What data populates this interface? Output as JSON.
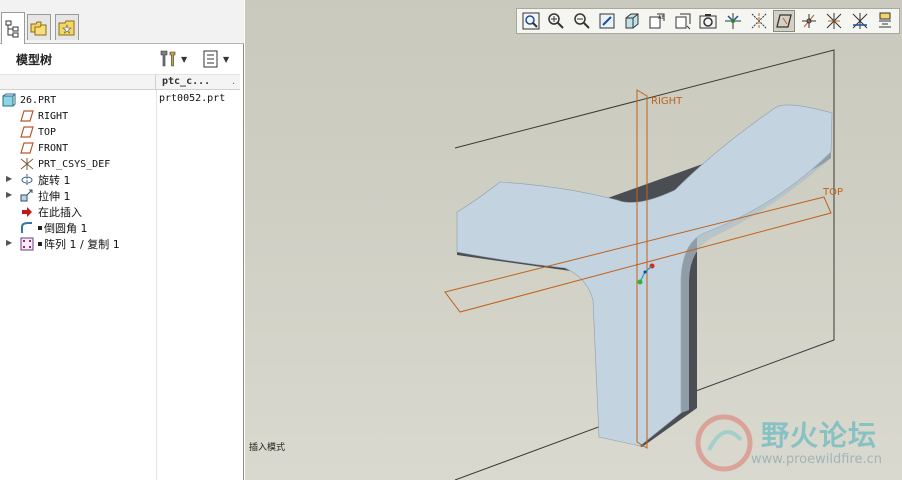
{
  "left_panel": {
    "tabs": [
      {
        "name": "model-tree-tab",
        "icon": "model-tree-icon"
      },
      {
        "name": "folder-browser-tab",
        "icon": "folders-icon"
      },
      {
        "name": "favorites-tab",
        "icon": "favorites-icon"
      }
    ],
    "title": "模型树",
    "settings_icon": "tree-settings-icon",
    "show_icon": "tree-show-icon",
    "columns": {
      "name": "",
      "file": "ptc_c...",
      "extra": "."
    },
    "items": [
      {
        "label": "26.PRT",
        "file": "prt0052.prt",
        "icon": "part-icon",
        "expandable": false
      },
      {
        "label": "RIGHT",
        "icon": "datum-plane-icon",
        "expandable": false
      },
      {
        "label": "TOP",
        "icon": "datum-plane-icon",
        "expandable": false
      },
      {
        "label": "FRONT",
        "icon": "datum-plane-icon",
        "expandable": false
      },
      {
        "label": "PRT_CSYS_DEF",
        "icon": "csys-icon",
        "expandable": false
      },
      {
        "label": "旋转 1",
        "icon": "revolve-icon",
        "expandable": true
      },
      {
        "label": "拉伸 1",
        "icon": "extrude-icon",
        "expandable": true
      },
      {
        "label": "在此插入",
        "icon": "insert-here-icon",
        "expandable": false
      },
      {
        "label": "倒圆角 1",
        "icon": "round-icon",
        "expandable": false
      },
      {
        "label": "阵列 1 / 复制 1",
        "icon": "pattern-icon",
        "expandable": true
      }
    ]
  },
  "graphics": {
    "toolbar": [
      "zoom-fit-icon",
      "zoom-in-icon",
      "zoom-out-icon",
      "repaint-icon",
      "shading-icon",
      "view-manager-icon",
      "saved-views-icon",
      "screenshot-icon",
      "spin-center-icon",
      "datum-axes-icon",
      "datum-planes-icon",
      "datum-points-icon",
      "csys-display-icon",
      "annotations-icon",
      "display-style-icon"
    ],
    "pressed_tool": 10,
    "datum_labels": {
      "right": "RIGHT",
      "top": "TOP"
    },
    "status": "插入模式",
    "watermark": {
      "cn": "野火论坛",
      "url": "www.proewildfire.cn"
    }
  },
  "colors": {
    "datum": "#c0621c",
    "part": "#c3d3df",
    "part_edge": "#4a4e52",
    "background": "#cfcfc4"
  }
}
